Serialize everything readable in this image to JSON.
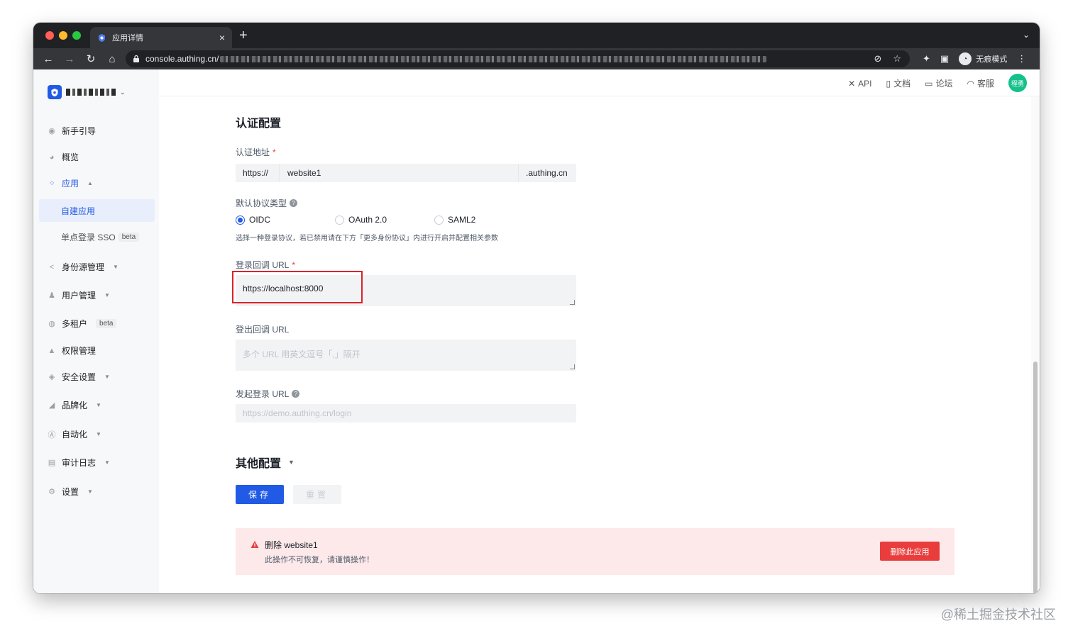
{
  "browser": {
    "tab_title": "应用详情",
    "new_tab": "+",
    "url": "console.authing.cn/",
    "incognito_label": "无痕模式"
  },
  "sidebar": {
    "items": [
      {
        "label": "新手引导"
      },
      {
        "label": "概览"
      },
      {
        "label": "应用"
      },
      {
        "label": "自建应用"
      },
      {
        "label": "单点登录 SSO",
        "badge": "beta"
      },
      {
        "label": "身份源管理"
      },
      {
        "label": "用户管理"
      },
      {
        "label": "多租户",
        "badge": "beta"
      },
      {
        "label": "权限管理"
      },
      {
        "label": "安全设置"
      },
      {
        "label": "品牌化"
      },
      {
        "label": "自动化"
      },
      {
        "label": "审计日志"
      },
      {
        "label": "设置"
      }
    ]
  },
  "topbar": {
    "links": [
      "API",
      "文档",
      "论坛",
      "客服"
    ],
    "avatar_text": "程勇"
  },
  "form": {
    "section_title": "认证配置",
    "address_label": "认证地址",
    "address_prefix": "https://",
    "address_value": "website1",
    "address_suffix": ".authing.cn",
    "protocol_label": "默认协议类型",
    "protocols": [
      "OIDC",
      "OAuth 2.0",
      "SAML2"
    ],
    "selected_protocol": "OIDC",
    "protocol_hint": "选择一种登录协议，若已禁用请在下方「更多身份协议」内进行开启并配置相关参数",
    "login_callback_label": "登录回调 URL",
    "login_callback_value": "https://localhost:8000",
    "logout_callback_label": "登出回调 URL",
    "logout_callback_placeholder": "多个 URL 用英文逗号「,」隔开",
    "initiate_login_label": "发起登录 URL",
    "initiate_login_placeholder": "https://demo.authing.cn/login",
    "other_section_title": "其他配置",
    "save_label": "保存",
    "reset_label": "重置"
  },
  "danger": {
    "title": "删除 website1",
    "description": "此操作不可恢复，请谨慎操作！",
    "delete_label": "删除此应用"
  },
  "watermark": "@稀土掘金技术社区",
  "colors": {
    "primary": "#215ae5",
    "danger": "#e93d3d",
    "highlight": "#d9232b"
  }
}
